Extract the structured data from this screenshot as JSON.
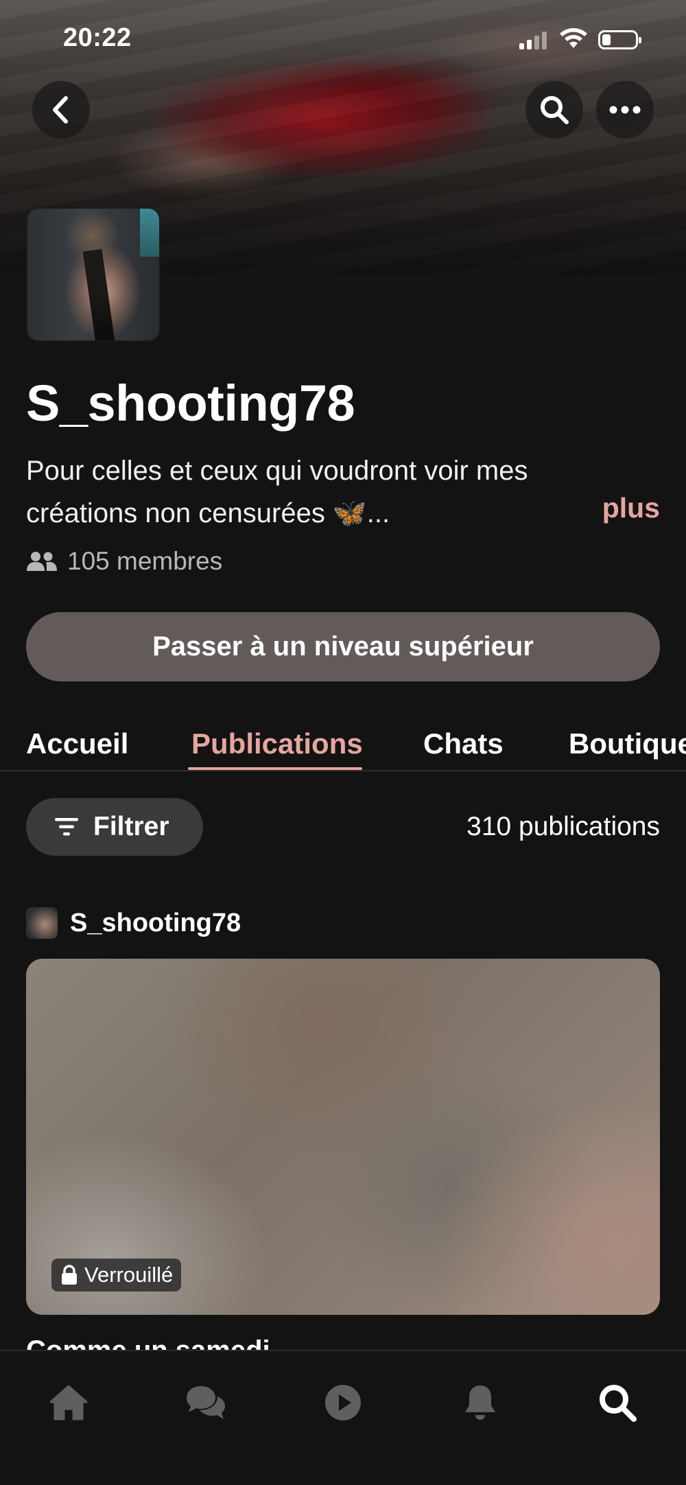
{
  "status_bar": {
    "time": "20:22"
  },
  "profile": {
    "name": "S_shooting78",
    "bio_line1": "Pour celles et ceux qui voudront voir mes",
    "bio_line2": "créations non censurées 🦋...",
    "more_label": "plus",
    "members": "105 membres"
  },
  "upgrade_label": "Passer à un niveau supérieur",
  "tabs": [
    {
      "label": "Accueil",
      "active": false
    },
    {
      "label": "Publications",
      "active": true
    },
    {
      "label": "Chats",
      "active": false
    },
    {
      "label": "Boutique",
      "active": false
    }
  ],
  "filter_label": "Filtrer",
  "post_count": "310 publications",
  "post": {
    "author": "S_shooting78",
    "locked_label": "Verrouillé"
  },
  "next_post_title": "Comme un samedi",
  "bottom_nav": [
    {
      "icon": "home-icon"
    },
    {
      "icon": "chat-icon"
    },
    {
      "icon": "play-icon"
    },
    {
      "icon": "bell-icon"
    },
    {
      "icon": "search-icon",
      "active": true
    }
  ],
  "colors": {
    "background": "#131313",
    "accent": "#e6a5a0",
    "upgrade_button": "#625b5a",
    "filter_button": "#3a3a3a"
  }
}
